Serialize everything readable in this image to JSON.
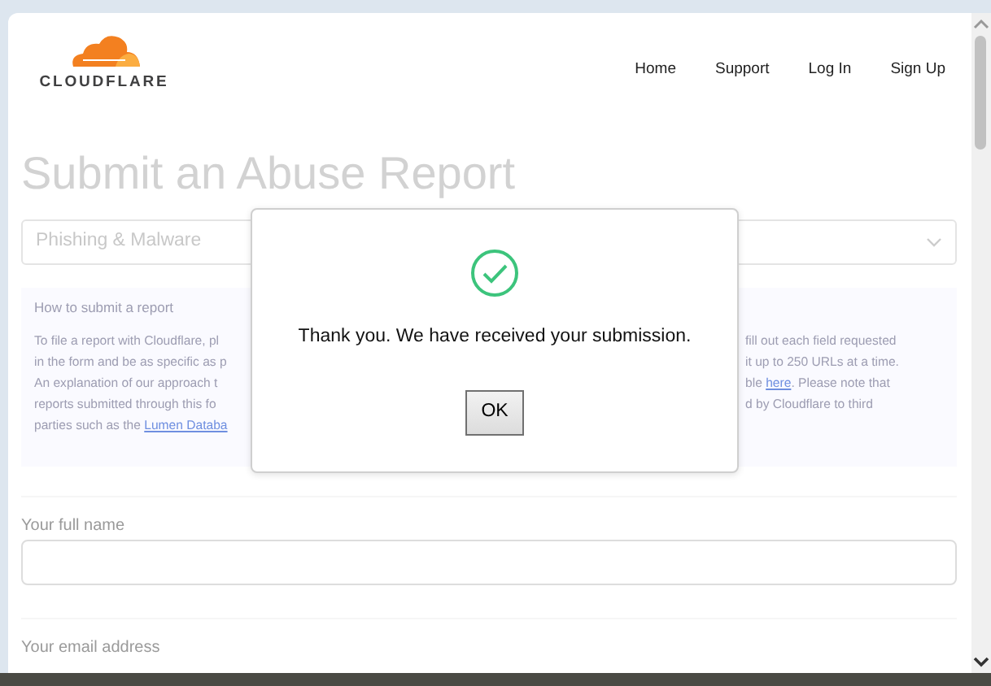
{
  "logo": {
    "text": "CLOUDFLARE"
  },
  "nav": [
    "Home",
    "Support",
    "Log In",
    "Sign Up"
  ],
  "title": "Submit an Abuse Report",
  "report_type": {
    "value": "Phishing & Malware"
  },
  "info": {
    "heading": "How to submit a report",
    "left_lines": [
      [
        {
          "kind": "text",
          "text": "To file a report with Cloudflare, pl"
        }
      ],
      [
        {
          "kind": "text",
          "text": "in the form and be as specific as p"
        }
      ],
      [
        {
          "kind": "text",
          "text": "An explanation of our approach t"
        }
      ],
      [
        {
          "kind": "text",
          "text": "reports submitted through this fo"
        }
      ],
      [
        {
          "kind": "text",
          "text": "parties such as the "
        },
        {
          "kind": "link",
          "text": "Lumen Databa"
        }
      ]
    ],
    "right_lines": [
      [
        {
          "kind": "text",
          "text": "fill out each field requested"
        }
      ],
      [
        {
          "kind": "text",
          "text": "it up to 250 URLs at a time."
        }
      ],
      [
        {
          "kind": "text",
          "text": "ble "
        },
        {
          "kind": "link",
          "text": "here"
        },
        {
          "kind": "text",
          "text": ". Please note that"
        }
      ],
      [
        {
          "kind": "text",
          "text": "d by Cloudflare to third"
        }
      ]
    ]
  },
  "fields": [
    {
      "kind": "input",
      "label": "Your full name"
    },
    {
      "kind": "label",
      "label": "Your email address"
    }
  ],
  "dialog": {
    "message": "Thank you. We have received your submission.",
    "button": "OK"
  }
}
